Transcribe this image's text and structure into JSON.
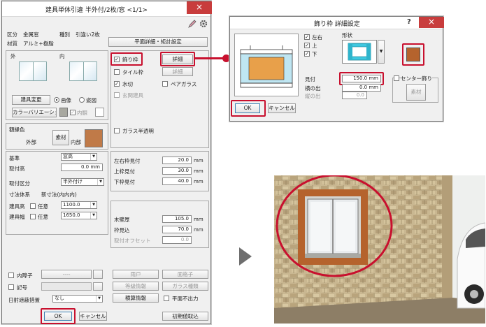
{
  "main": {
    "title": "建具単体引違 半外付/2枚/窓 <1/1>",
    "close": "×",
    "category_label": "区分",
    "category_value": "金属窓",
    "kind_label": "種別",
    "kind_value": "引違い2枚",
    "material_label": "材質",
    "material_value": "アルミ+樹脂",
    "plan_button": "平面詳細・矩計設定",
    "outside_label": "外",
    "inside_label": "内",
    "change_button": "建具変更",
    "radio_image": "画像",
    "radio_shape": "姿図",
    "color_variation_button": "カラーバリエーション",
    "inside_check": "内観",
    "frame_color_label": "額縁色",
    "outside_side": "外部",
    "inside_side": "内部",
    "material_button": "素材",
    "decor_frame": "飾り枠",
    "detail_button": "詳細",
    "tile_frame": "タイル枠",
    "detail_button_2": "詳細",
    "water_cut": "水切",
    "pair_glass": "ペアガラス",
    "entrance": "玄関建具",
    "semi_transparent": "ガラス半透明",
    "base_label": "基準",
    "base_value": "窓高",
    "mount_height_label": "取付高",
    "mount_height_value": "0.0 mm",
    "mount_type_label": "取付区分",
    "mount_type_value": "半外付け",
    "dimension_system_label": "寸法体系",
    "dimension_system_value": "新寸法(内内内)",
    "height_label": "建具高",
    "width_label": "建具幅",
    "optional": "任意",
    "height_value": "1100.0",
    "width_value": "1650.0",
    "lr_frame_label": "左右枠見付",
    "lr_frame_value": "20.0",
    "top_frame_label": "上枠見付",
    "top_frame_value": "30.0",
    "bottom_frame_label": "下枠見付",
    "bottom_frame_value": "40.0",
    "wall_thickness_label": "木壁厚",
    "wall_thickness_value": "105.0",
    "frame_depth_label": "枠見込",
    "frame_depth_value": "70.0",
    "offset_label": "取付オフセット",
    "offset_value": "0.0",
    "unit_mm": "mm",
    "inner_shoji": "内障子",
    "inner_shoji_value": "----",
    "symbol": "記号",
    "sun_shading_label": "日射遮蔽措置",
    "sun_shading_value": "なし",
    "shutter_button": "雨戸",
    "grid_button": "面格子",
    "grade_button": "等級情報",
    "glass_button": "ガラス種類",
    "estimate_button": "積算情報",
    "no_plan_output": "平面不出力",
    "ok_button": "OK",
    "cancel_button": "キャンセル",
    "initial_button": "初期値取込"
  },
  "detail": {
    "title": "飾り枠 詳細設定",
    "help": "?",
    "close": "×",
    "check_lr": "左右",
    "check_top": "上",
    "check_bottom": "下",
    "shape_label": "形状",
    "mitsuke_label": "見付",
    "mitsuke_value": "150.0 mm",
    "side_out_label": "横の出",
    "side_out_value": "0.0 mm",
    "bottom_out_label": "縦の出",
    "bottom_out_value": "0.0",
    "center_check": "センター飾り",
    "material_button": "素材",
    "ok_button": "OK",
    "cancel_button": "キャンセル"
  },
  "arrow": "▶",
  "colors": {
    "accent_red": "#c8102e",
    "wood": "#b5632d",
    "close_red": "#c83c3c"
  }
}
